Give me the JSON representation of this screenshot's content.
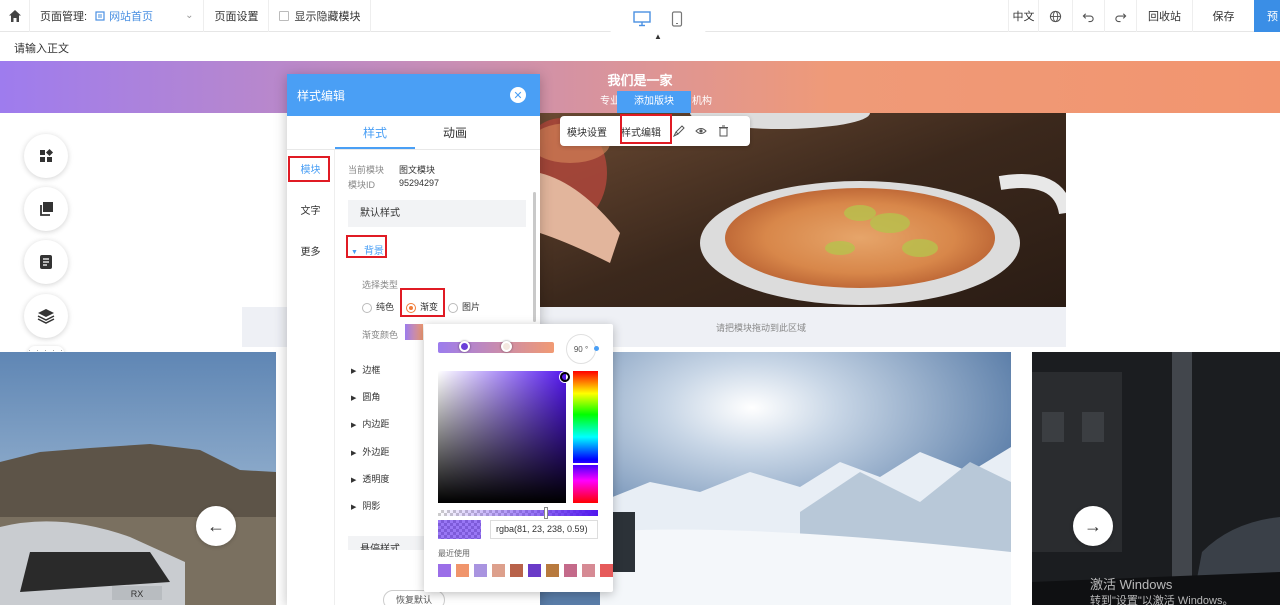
{
  "toolbar": {
    "page_manage_label": "页面管理:",
    "current_page": "网站首页",
    "page_settings": "页面设置",
    "show_hidden": "显示隐藏模块",
    "lang": "中文",
    "recycle": "回收站",
    "save": "保存",
    "publish": "预"
  },
  "editor": {
    "body_placeholder": "请输入正文"
  },
  "banner": {
    "title": "我们是一家",
    "subtitle_a": "专业",
    "subtitle_b": "机构",
    "add_block": "添加版块"
  },
  "block_bar": {
    "module_settings": "模块设置",
    "style_edit": "样式编辑"
  },
  "drop_zone": "请把模块拖动到此区域",
  "panel": {
    "title": "样式编辑",
    "tabs": [
      "样式",
      "动画"
    ],
    "side_nav": [
      "模块",
      "文字",
      "更多"
    ],
    "current_module_label": "当前模块",
    "current_module_value": "图文模块",
    "module_id_label": "模块ID",
    "module_id_value": "95294297",
    "default_style": "默认样式",
    "bg_section": "背景",
    "select_type": "选择类型",
    "types": [
      "纯色",
      "渐变",
      "图片"
    ],
    "gradient_color": "渐变颜色",
    "sections": [
      "边框",
      "圆角",
      "内边距",
      "外边距",
      "透明度",
      "阴影"
    ],
    "bottom_cut": "悬停样式",
    "restore": "恢复默认"
  },
  "picker": {
    "angle": "90 °",
    "rgba": "rgba(81, 23, 238, 0.59)",
    "recent_label": "最近使用",
    "recent_colors": [
      "#9b6ee8",
      "#f0956c",
      "#a994e0",
      "#dda08c",
      "#b8624a",
      "#6a3bc8",
      "#b87a3e",
      "#c46a8a",
      "#d68a94",
      "#e65a5a"
    ]
  },
  "watermark": {
    "line1": "激活 Windows",
    "line2": "转到\"设置\"以激活 Windows。"
  },
  "colors": {
    "accent": "#4a9ff5",
    "highlight": "#e01b24"
  }
}
